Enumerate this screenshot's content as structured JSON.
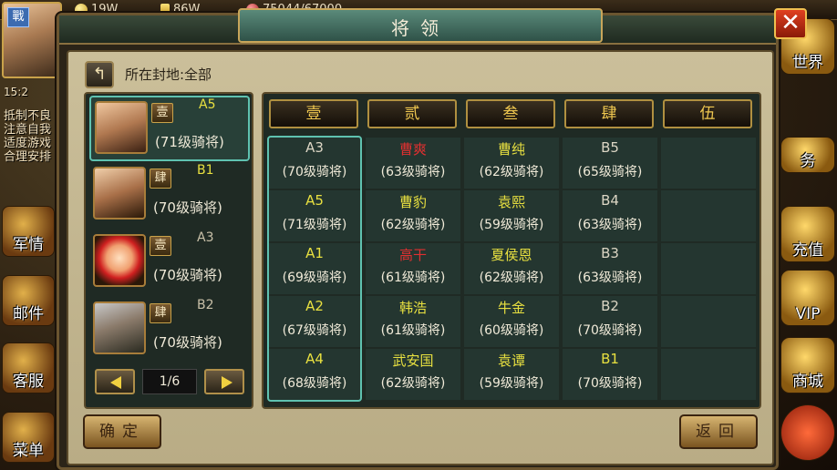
{
  "hud": {
    "copper": "19W",
    "gold": "86W",
    "troops": "75044/67000",
    "zhan_label": "戰",
    "time": "15:2",
    "side_note": "抵制不良\n注意自我\n适度游戏\n合理安排",
    "left_buttons": [
      "军情",
      "邮件",
      "客服",
      "菜单"
    ],
    "right_buttons": [
      "世界",
      "务",
      "充值",
      "VIP",
      "商城"
    ]
  },
  "dialog": {
    "title": "将领",
    "close_label": "✕",
    "back_icon": "back-arrow-icon",
    "filter_label": "所在封地:全部",
    "confirm_label": "确定",
    "return_label": "返回"
  },
  "generals": [
    {
      "badge": "壹",
      "slot": "A5",
      "desc": "(71级骑将)",
      "selected": true
    },
    {
      "badge": "肆",
      "slot": "B1",
      "desc": "(70级骑将)",
      "selected": false
    },
    {
      "badge": "壹",
      "slot": "A3",
      "desc": "(70级骑将)",
      "selected": false
    },
    {
      "badge": "肆",
      "slot": "B2",
      "desc": "(70级骑将)",
      "selected": false
    }
  ],
  "pager": {
    "page": "1/6"
  },
  "formation": {
    "columns": [
      "壹",
      "贰",
      "叁",
      "肆",
      "伍"
    ],
    "rows": [
      [
        {
          "name": "A3",
          "desc": "(70级骑将)",
          "color": "white"
        },
        {
          "name": "曹爽",
          "desc": "(63级骑将)",
          "color": "red"
        },
        {
          "name": "曹纯",
          "desc": "(62级骑将)",
          "color": "yellow"
        },
        {
          "name": "B5",
          "desc": "(65级骑将)",
          "color": "white"
        }
      ],
      [
        {
          "name": "A5",
          "desc": "(71级骑将)",
          "color": "yellow"
        },
        {
          "name": "曹豹",
          "desc": "(62级骑将)",
          "color": "yellow"
        },
        {
          "name": "袁熙",
          "desc": "(59级骑将)",
          "color": "yellow"
        },
        {
          "name": "B4",
          "desc": "(63级骑将)",
          "color": "white"
        }
      ],
      [
        {
          "name": "A1",
          "desc": "(69级骑将)",
          "color": "yellow"
        },
        {
          "name": "高干",
          "desc": "(61级骑将)",
          "color": "red"
        },
        {
          "name": "夏侯恩",
          "desc": "(62级骑将)",
          "color": "yellow"
        },
        {
          "name": "B3",
          "desc": "(63级骑将)",
          "color": "white"
        }
      ],
      [
        {
          "name": "A2",
          "desc": "(67级骑将)",
          "color": "yellow"
        },
        {
          "name": "韩浩",
          "desc": "(61级骑将)",
          "color": "yellow"
        },
        {
          "name": "牛金",
          "desc": "(60级骑将)",
          "color": "yellow"
        },
        {
          "name": "B2",
          "desc": "(70级骑将)",
          "color": "white"
        }
      ],
      [
        {
          "name": "A4",
          "desc": "(68级骑将)",
          "color": "yellow"
        },
        {
          "name": "武安国",
          "desc": "(62级骑将)",
          "color": "yellow"
        },
        {
          "name": "袁谭",
          "desc": "(59级骑将)",
          "color": "yellow"
        },
        {
          "name": "B1",
          "desc": "(70级骑将)",
          "color": "yellow"
        }
      ]
    ]
  }
}
